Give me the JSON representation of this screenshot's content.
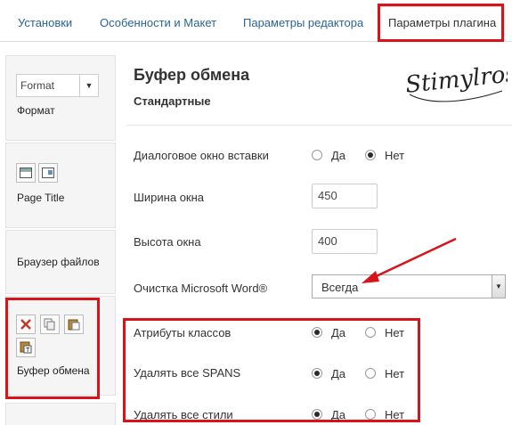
{
  "tabs": [
    {
      "label": "Установки"
    },
    {
      "label": "Особенности и Макет"
    },
    {
      "label": "Параметры редактора"
    },
    {
      "label": "Параметры плагина",
      "active": true
    }
  ],
  "sidebar": {
    "items": [
      {
        "label": "Формат",
        "select_value": "Format"
      },
      {
        "label": "Page Title"
      },
      {
        "label": "Браузер файлов"
      },
      {
        "label": "Буфер обмена"
      }
    ]
  },
  "main": {
    "title": "Буфер обмена",
    "subtitle": "Стандартные",
    "signature": "Stimylrosta",
    "radio_yes": "Да",
    "radio_no": "Нет",
    "fields": [
      {
        "label": "Диалоговое окно вставки",
        "type": "radio",
        "value": "Нет"
      },
      {
        "label": "Ширина окна",
        "type": "text",
        "value": "450"
      },
      {
        "label": "Высота окна",
        "type": "text",
        "value": "400"
      },
      {
        "label": "Очистка Microsoft Word®",
        "type": "select",
        "value": "Всегда"
      },
      {
        "label": "Атрибуты классов",
        "type": "radio",
        "value": "Да"
      },
      {
        "label": "Удалять все SPANS",
        "type": "radio",
        "value": "Да"
      },
      {
        "label": "Удалять все стили",
        "type": "radio",
        "value": "Да"
      }
    ]
  },
  "colors": {
    "highlight": "#d9131a",
    "link": "#2a6496"
  }
}
